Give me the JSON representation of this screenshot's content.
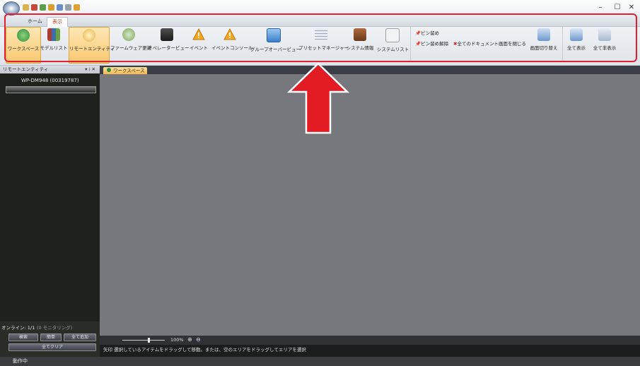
{
  "titlebar": {
    "window_controls": [
      "–",
      "☐",
      "✕"
    ]
  },
  "tabs": [
    {
      "label": "ホーム",
      "active": false
    },
    {
      "label": "表示",
      "active": true
    }
  ],
  "ribbon": {
    "buttons": [
      {
        "label": "ワークスペース",
        "icon": "globe-icon",
        "color": "#2f8f3f",
        "selected": true
      },
      {
        "label": "モデルリスト",
        "icon": "model-list-icon",
        "color": "#b03a2e",
        "selected": false
      },
      {
        "label": "リモートエンティティ",
        "icon": "remote-entity-icon",
        "color": "#e8b24a",
        "selected": true
      },
      {
        "label": "ファームウェア更新",
        "icon": "firmware-update-icon",
        "color": "#7aa55a",
        "selected": false
      },
      {
        "label": "オペレータービュー",
        "icon": "operator-view-icon",
        "color": "#3a3a3a",
        "selected": false
      },
      {
        "label": "イベント",
        "icon": "warning-icon",
        "color": "#e8a020",
        "selected": false
      },
      {
        "label": "イベントコンソール",
        "icon": "warning-icon",
        "color": "#e8a020",
        "selected": false
      },
      {
        "label": "グループオーバービュー",
        "icon": "group-overview-icon",
        "color": "#4a8ed8",
        "selected": false
      },
      {
        "label": "プリセットマネージャー",
        "icon": "preset-manager-icon",
        "color": "#9aa6b8",
        "selected": false
      },
      {
        "label": "システム情報",
        "icon": "briefcase-icon",
        "color": "#8a4a2a",
        "selected": false
      },
      {
        "label": "システムリスト",
        "icon": "document-icon",
        "color": "#c8ccd2",
        "selected": false
      }
    ],
    "pin": "ピン留め",
    "unpin": "ピン留め解除",
    "close_all_docs": "全てのドキュメント画面を閉じる",
    "switch_screen": "画面切り替え",
    "show_all": "全て表示",
    "hide_all": "全て非表示"
  },
  "left_panel": {
    "title": "リモートエンティティ",
    "header_controls": "▾ ⁞ ✕",
    "device_name": "WP-DM948 (00319787)",
    "online_label": "オンライン: 1/1",
    "monitoring_label": "(0 モニタリング)",
    "search_button": "検索",
    "simple_button": "簡単",
    "add_all_button": "全て追加",
    "clear_all_button": "全てクリア"
  },
  "main": {
    "doc_tab_label": "ワークスペース",
    "zoom_level": "100%",
    "status_hint": "矢印 選択しているアイテムをドラッグして移動。または、空のエリアをドラッグしてエリアを選択"
  },
  "status_bar": {
    "status": "動作中"
  },
  "colors": {
    "highlight": "#e02030",
    "arrow": "#e31b23"
  }
}
